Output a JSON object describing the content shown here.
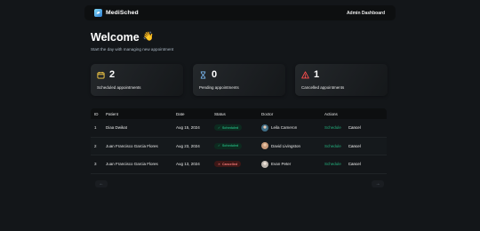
{
  "header": {
    "brand": "MediSched",
    "right_label": "Admin Dashboard"
  },
  "welcome": {
    "title": "Welcome",
    "emoji": "👋",
    "subtitle": "Start the day with managing new appointment"
  },
  "stats": [
    {
      "count": "2",
      "label": "Scheduled appointments",
      "icon": "calendar-icon",
      "color": "#ffd147"
    },
    {
      "count": "0",
      "label": "Pending appointments",
      "icon": "hourglass-icon",
      "color": "#79b5ec"
    },
    {
      "count": "1",
      "label": "Cancelled appointments",
      "icon": "warning-icon",
      "color": "#ff4f4e"
    }
  ],
  "table": {
    "columns": [
      "ID",
      "Patient",
      "Date",
      "Status",
      "Doctor",
      "Actions"
    ],
    "rows": [
      {
        "id": "1",
        "patient": "Diaa Dwikat",
        "date": "Aug 15, 2024",
        "status": "Scheduled",
        "status_key": "scheduled",
        "doctor": "Leila Cameron",
        "avatar_color": "#3f6e86",
        "action_primary": "Schedule",
        "action_secondary": "Cancel"
      },
      {
        "id": "2",
        "patient": "Juan Francisco Garcia Flores",
        "date": "Aug 23, 2024",
        "status": "Scheduled",
        "status_key": "scheduled",
        "doctor": "David Livingston",
        "avatar_color": "#c89a7a",
        "action_primary": "Schedule",
        "action_secondary": "Cancel"
      },
      {
        "id": "3",
        "patient": "Juan Francisco Garcia Flores",
        "date": "Aug 13, 2024",
        "status": "Cancelled",
        "status_key": "cancelled",
        "doctor": "Evan Peter",
        "avatar_color": "#d9d4cf",
        "action_primary": "Schedule",
        "action_secondary": "Cancel"
      }
    ]
  },
  "pagination": {
    "prev_icon": "arrow-left-icon",
    "next_icon": "arrow-right-icon",
    "prev_glyph": "←",
    "next_glyph": "→"
  },
  "colors": {
    "background": "#131619",
    "panel": "#0d0f10",
    "green": "#24ae7c",
    "red": "#f37877"
  }
}
